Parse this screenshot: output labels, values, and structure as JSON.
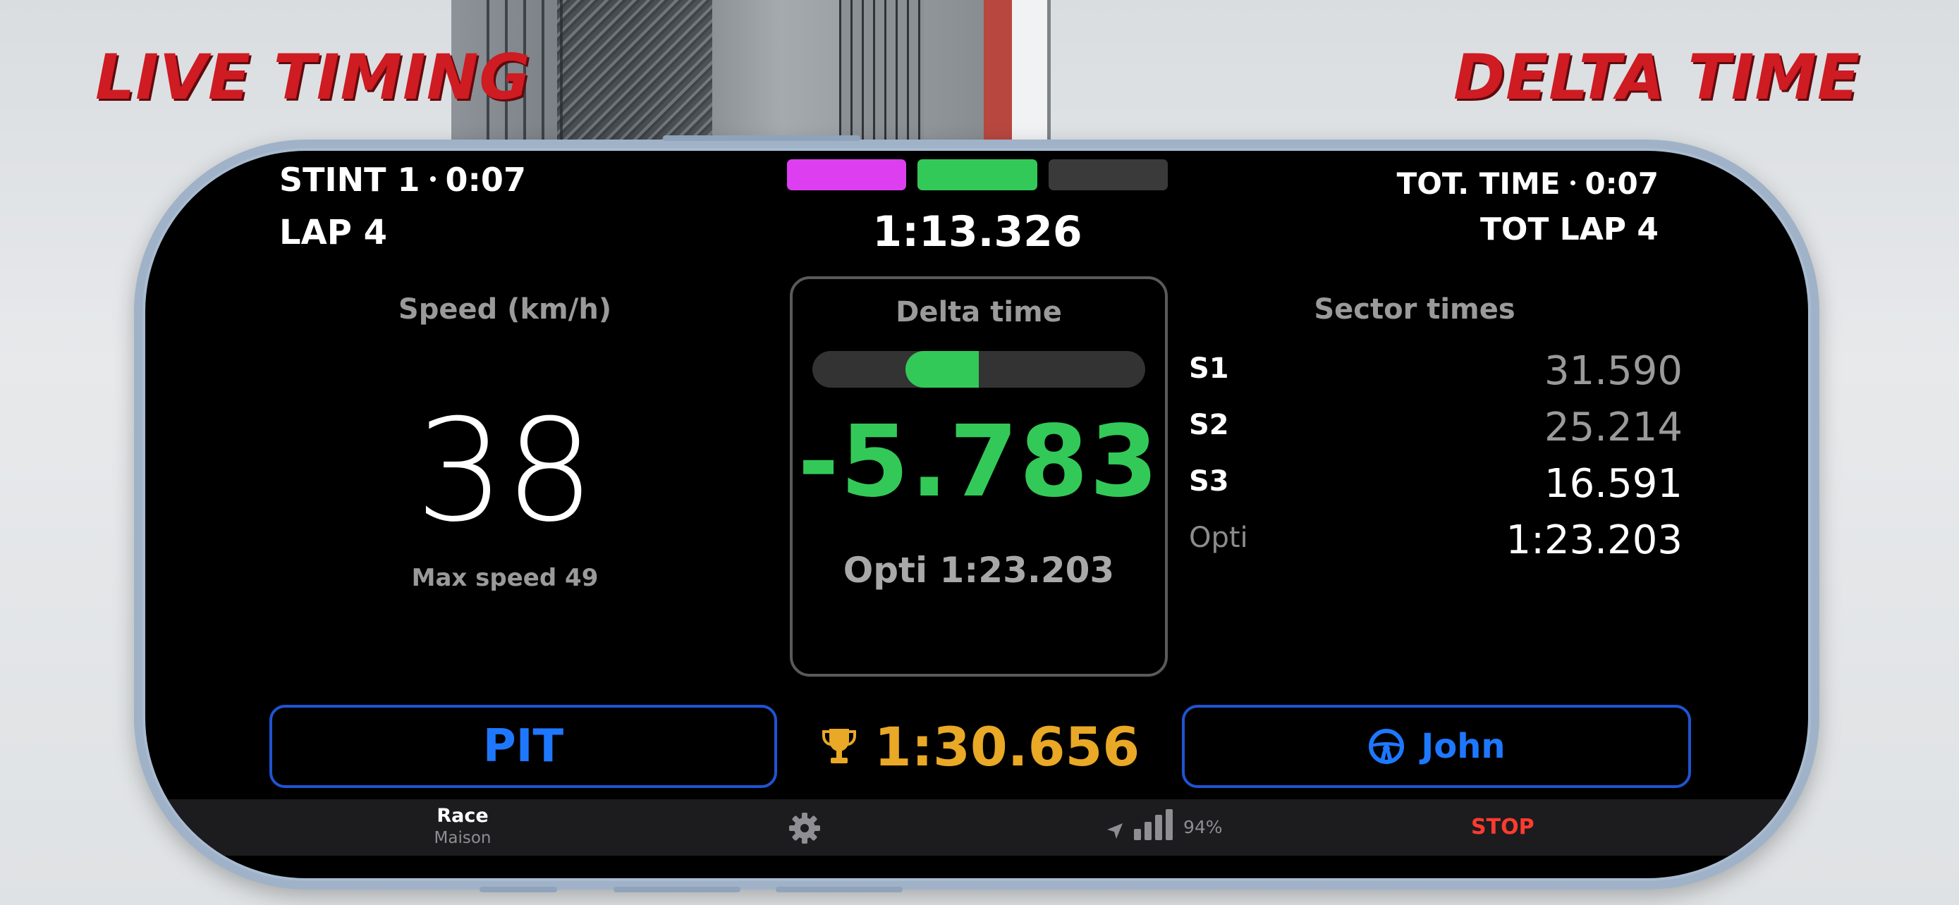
{
  "headlines": {
    "left": "LIVE TIMING",
    "right": "DELTA TIME"
  },
  "header": {
    "stint_label": "STINT 1",
    "stint_time": "0:07",
    "lap_label": "LAP 4",
    "current_lap_time": "1:13.326",
    "total_time_label": "TOT. TIME",
    "total_time": "0:07",
    "total_lap_label": "TOT LAP 4",
    "sector_bars": [
      {
        "color": "#dd3ff0"
      },
      {
        "color": "#33c958"
      },
      {
        "color": "#3a3a3a"
      }
    ]
  },
  "speed": {
    "title": "Speed (km/h)",
    "value": "38",
    "max_label": "Max speed 49"
  },
  "delta": {
    "title": "Delta time",
    "value": "-5.783",
    "bar_fill_start": 0.28,
    "bar_fill_end": 0.5,
    "opti": "Opti 1:23.203"
  },
  "sectors": {
    "title": "Sector times",
    "rows": [
      {
        "label": "S1",
        "value": "31.590",
        "dim": true
      },
      {
        "label": "S2",
        "value": "25.214",
        "dim": true
      },
      {
        "label": "S3",
        "value": "16.591",
        "dim": false
      },
      {
        "label": "Opti",
        "value": "1:23.203",
        "dim": false
      }
    ]
  },
  "buttons": {
    "pit": "PIT",
    "driver": "John",
    "best_lap": "1:30.656"
  },
  "statusbar": {
    "race_label": "Race",
    "race_sub": "Maison",
    "battery": "94%",
    "stop": "STOP"
  },
  "colors": {
    "accent_green": "#33c958",
    "accent_blue": "#1e78ff",
    "accent_gold": "#e9a825",
    "stop_red": "#ff3b30"
  }
}
